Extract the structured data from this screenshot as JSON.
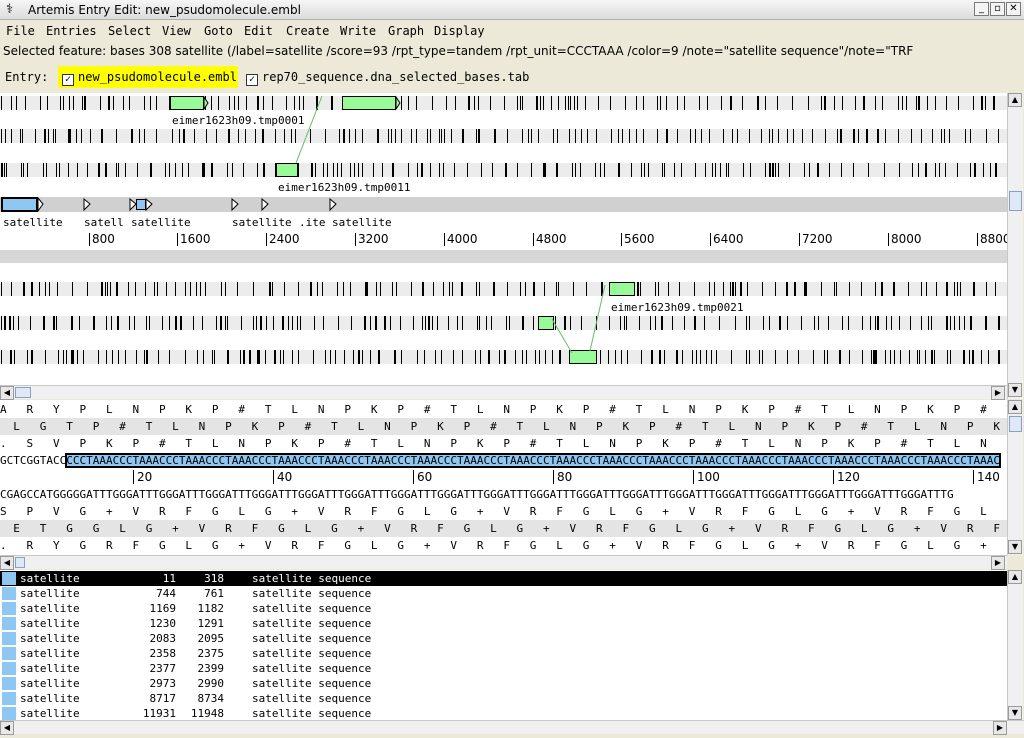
{
  "window": {
    "title": "Artemis Entry Edit: new_psudomolecule.embl",
    "buttons": [
      "_",
      "▫",
      "✕"
    ]
  },
  "menu": [
    "File",
    "Entries",
    "Select",
    "View",
    "Goto",
    "Edit",
    "Create",
    "Write",
    "Graph",
    "Display"
  ],
  "selected_feature": "Selected feature:  bases 308  satellite  (/label=satellite /score=93 /rpt_type=tandem /rpt_unit=CCCTAAA /color=9 /note=\"satellite sequence\"/note=\"TRF",
  "entry_bar": {
    "label": "Entry:",
    "entries": [
      {
        "name": "new_psudomolecule.embl",
        "checked": true,
        "highlight": "#ffff00"
      },
      {
        "name": "rep70_sequence.dna_selected_bases.tab",
        "checked": true
      }
    ]
  },
  "overview": {
    "feature_labels": [
      "eimer1623h09.tmp0001",
      "eimer1623h09.tmp0011",
      "eimer1623h09.tmp0021"
    ],
    "satellite_labels": [
      "satellite",
      "satell",
      "satellite",
      "satellite",
      ".ite",
      "satellite"
    ],
    "ruler": [
      "800",
      "1600",
      "2400",
      "3200",
      "4000",
      "4800",
      "5600",
      "6400",
      "7200",
      "8000",
      "8800"
    ]
  },
  "base_view": {
    "frames_forward": [
      "A   R   Y   P   L   N   P   K   P   #   T   L   N   P   K   P   #   T   L   N   P   K   P   #   T   L   N   P   K   P   #   T   L   N   P   K   P   #   T   L   N   P   K   P   #   T   L   N",
      "  L   G   T   P   #   T   L   N   P   K   P   #   T   L   N   P   K   P   #   T   L   N   P   K   P   #   T   L   N   P   K   P   #   T   L   N   P   K   P   #   T   L   N   P   K   P   #   T",
      ".   S   V   P   K   P   #   T   L   N   P   K   P   #   T   L   N   P   K   P   #   T   L   N   P   K   P   #   T   L   N   P   K   P   #   T   L   N   P   K   P   #   T   L   N   P   K"
    ],
    "dna_prefix": "GCTCGGTACC",
    "dna_selected": "CCCTAAACCCTAAACCCTAAACCCTAAACCCTAAACCCTAAACCCTAAACCCTAAACCCTAAACCCTAAACCCTAAACCCTAAACCCTAAACCCTAAACCCTAAACCCTAAACCCTAAACCCTAAACCCTAAACCCTAAAC",
    "ruler": [
      "20",
      "40",
      "60",
      "80",
      "100",
      "120",
      "140"
    ],
    "dna_reverse": "CGAGCCATGGGGGATTTGGGATTTGGGATTTGGGATTTGGGATTTGGGATTTGGGATTTGGGATTTGGGATTTGGGATTTGGGATTTGGGATTTGGGATTTGGGATTTGGGATTTGGGATTTGGGATTTGGGATTTGGGATTTG",
    "frames_reverse": [
      "S   P   V   G   +   V   R   F   G   L   G   +   V   R   F   G   L   G   +   V   R   F   G   L   G   +   V   R   F   G   L   G   +   V   R   F   G   L   G   +   V   R   F   G   L   G   +   V",
      "  E   T   G   G   L   G   +   V   R   F   G   L   G   +   V   R   F   G   L   G   +   V   R   F   G   L   G   +   V   R   F   G   L   G   +   V   R   F   G   L   G   +   V   R   F   G   L",
      ".   R   Y   G   R   F   G   L   G   +   V   R   F   G   L   G   +   V   R   F   G   L   G   +   V   R   F   G   L   G   +   V   R   F   G   L   G   +   V   R   F   G   L   G   +   V   R   F"
    ]
  },
  "feature_list": [
    {
      "key": "satellite",
      "start": "11",
      "end": "318",
      "note": "satellite sequence",
      "selected": true
    },
    {
      "key": "satellite",
      "start": "744",
      "end": "761",
      "note": "satellite sequence"
    },
    {
      "key": "satellite",
      "start": "1169",
      "end": "1182",
      "note": "satellite sequence"
    },
    {
      "key": "satellite",
      "start": "1230",
      "end": "1291",
      "note": "satellite sequence"
    },
    {
      "key": "satellite",
      "start": "2083",
      "end": "2095",
      "note": "satellite sequence"
    },
    {
      "key": "satellite",
      "start": "2358",
      "end": "2375",
      "note": "satellite sequence"
    },
    {
      "key": "satellite",
      "start": "2377",
      "end": "2399",
      "note": "satellite sequence"
    },
    {
      "key": "satellite",
      "start": "2973",
      "end": "2990",
      "note": "satellite sequence"
    },
    {
      "key": "satellite",
      "start": "8717",
      "end": "8734",
      "note": "satellite sequence"
    },
    {
      "key": "satellite",
      "start": "11931",
      "end": "11948",
      "note": "satellite sequence"
    }
  ],
  "colors": {
    "feature_green": "#98fb98",
    "feature_blue": "#8ec7f2",
    "entry_highlight": "#ffff00"
  }
}
